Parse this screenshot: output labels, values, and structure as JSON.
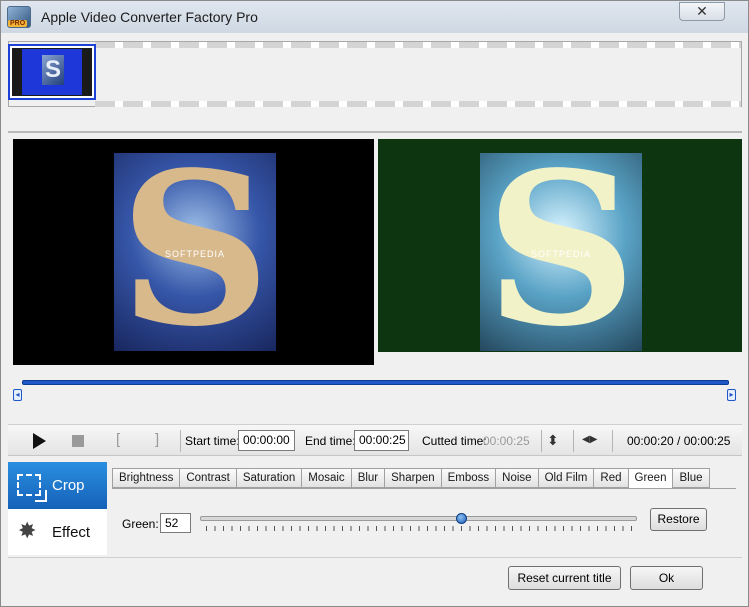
{
  "window": {
    "title": "Apple Video Converter Factory Pro",
    "icon_badge": "PRO",
    "close_glyph": "✕"
  },
  "thumbnail": {
    "glyph": "S"
  },
  "preview": {
    "glyph": "S",
    "watermark": "SOFTPEDIA"
  },
  "controls": {
    "play_icon": "play-icon",
    "stop_icon": "stop-icon",
    "mark_in_glyph": "[",
    "mark_out_glyph": "]",
    "start_label": "Start time:",
    "start_value": "00:00:00",
    "end_label": "End time:",
    "end_value": "00:00:25",
    "cutted_label": "Cutted time:",
    "cutted_value": "00:00:25",
    "flip_v_glyph": "⬍",
    "flip_h_glyph": "◀▶",
    "position": "00:00:20 / 00:00:25"
  },
  "side_tabs": {
    "crop": "Crop",
    "effect": "Effect",
    "effect_glyph": "✸"
  },
  "effect_tabs": [
    "Brightness",
    "Contrast",
    "Saturation",
    "Mosaic",
    "Blur",
    "Sharpen",
    "Emboss",
    "Noise",
    "Old Film",
    "Red",
    "Green",
    "Blue"
  ],
  "active_effect_tab": "Green",
  "effect_setting": {
    "label": "Green:",
    "value": "52",
    "slider_fraction": 0.6
  },
  "buttons": {
    "restore": "Restore",
    "reset": "Reset current title",
    "ok": "Ok"
  },
  "colors": {
    "accent": "#1f57c8",
    "crop_tab": "#1a74cc",
    "right_preview_bg": "#0d3510"
  }
}
